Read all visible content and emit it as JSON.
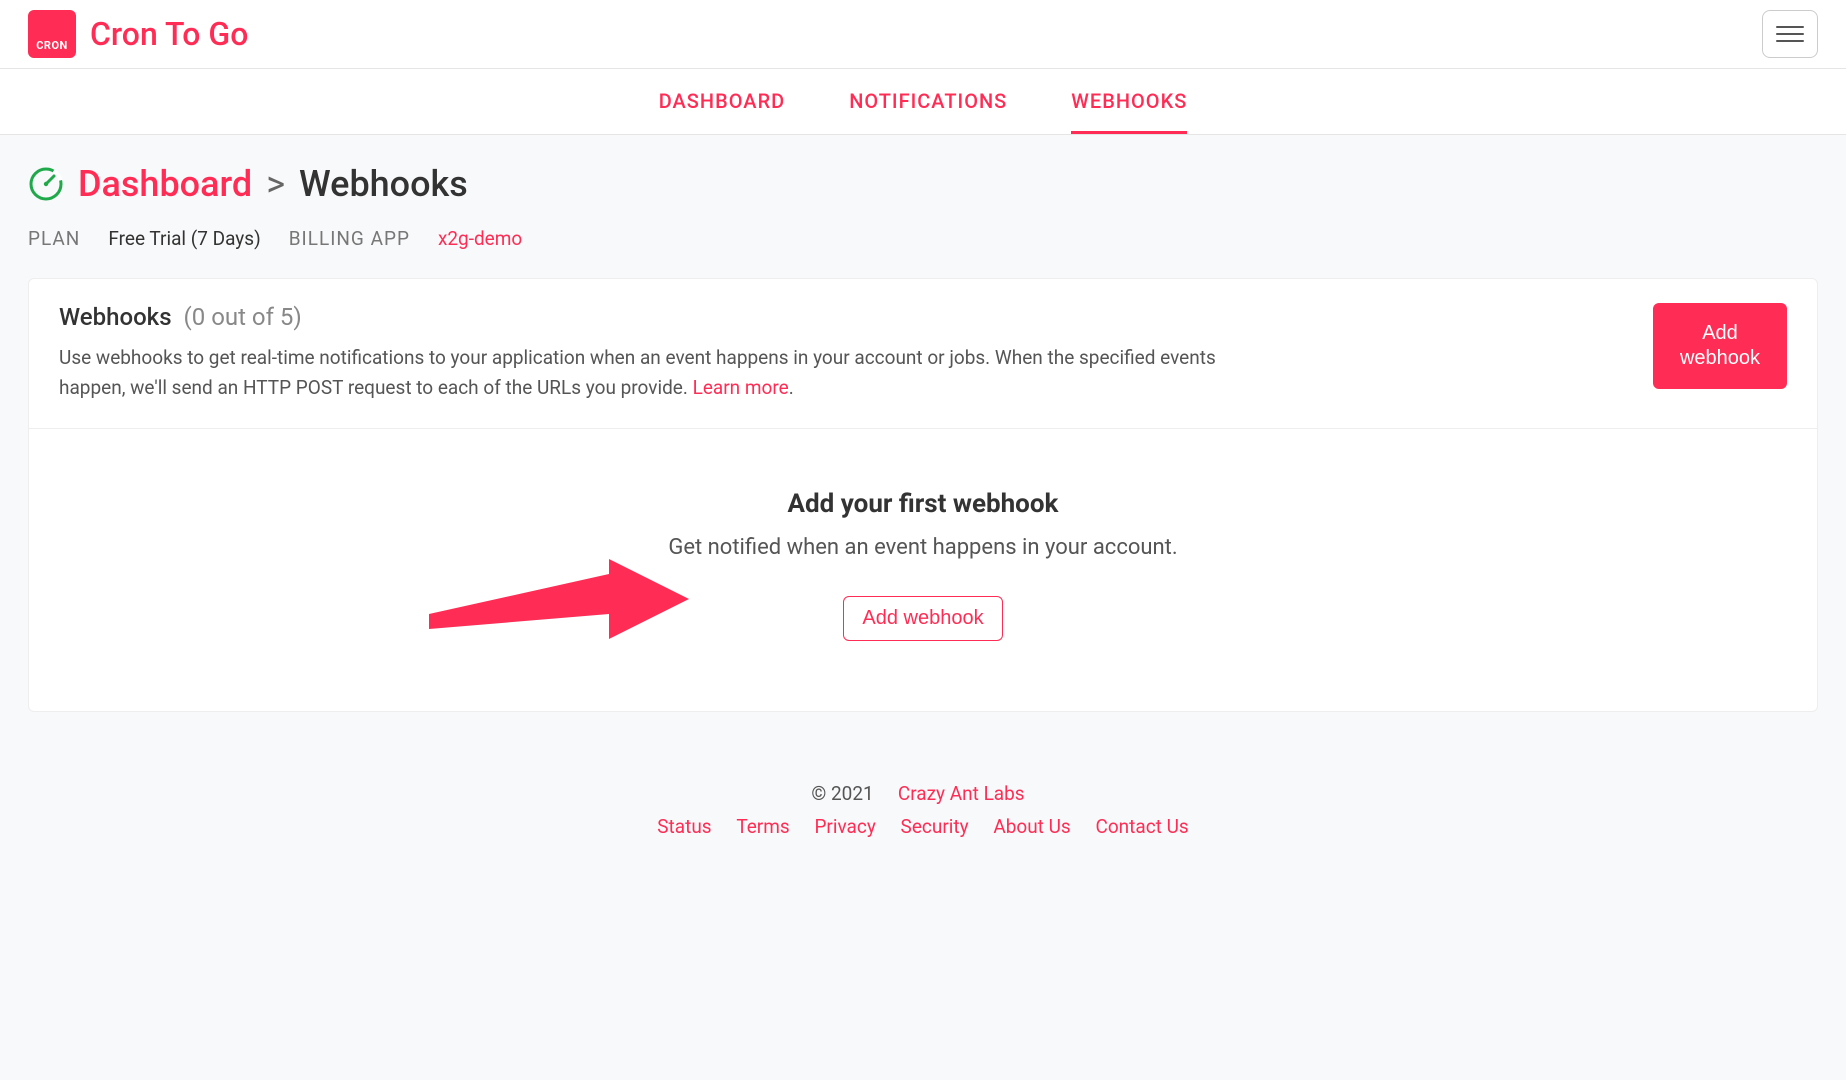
{
  "brand": {
    "logo_text": "CRON",
    "title": "Cron To Go"
  },
  "tabs": {
    "dashboard": "DASHBOARD",
    "notifications": "NOTIFICATIONS",
    "webhooks": "WEBHOOKS"
  },
  "breadcrumb": {
    "root": "Dashboard",
    "separator": ">",
    "current": "Webhooks"
  },
  "meta": {
    "plan_label": "PLAN",
    "plan_value": "Free Trial (7 Days)",
    "billing_label": "BILLING APP",
    "billing_value": "x2g-demo"
  },
  "card": {
    "title": "Webhooks",
    "count": "(0 out of 5)",
    "description": "Use webhooks to get real-time notifications to your application when an event happens in your account or jobs. When the specified events happen, we'll send an HTTP POST request to each of the URLs you provide.  ",
    "learn_more": "Learn more",
    "learn_more_suffix": ".",
    "add_button": "Add webhook"
  },
  "empty": {
    "title": "Add your first webhook",
    "subtitle": "Get notified when an event happens in your account.",
    "button": "Add webhook"
  },
  "footer": {
    "copyright": "© 2021",
    "company": "Crazy Ant Labs",
    "links": {
      "status": "Status",
      "terms": "Terms",
      "privacy": "Privacy",
      "security": "Security",
      "about": "About Us",
      "contact": "Contact Us"
    }
  }
}
